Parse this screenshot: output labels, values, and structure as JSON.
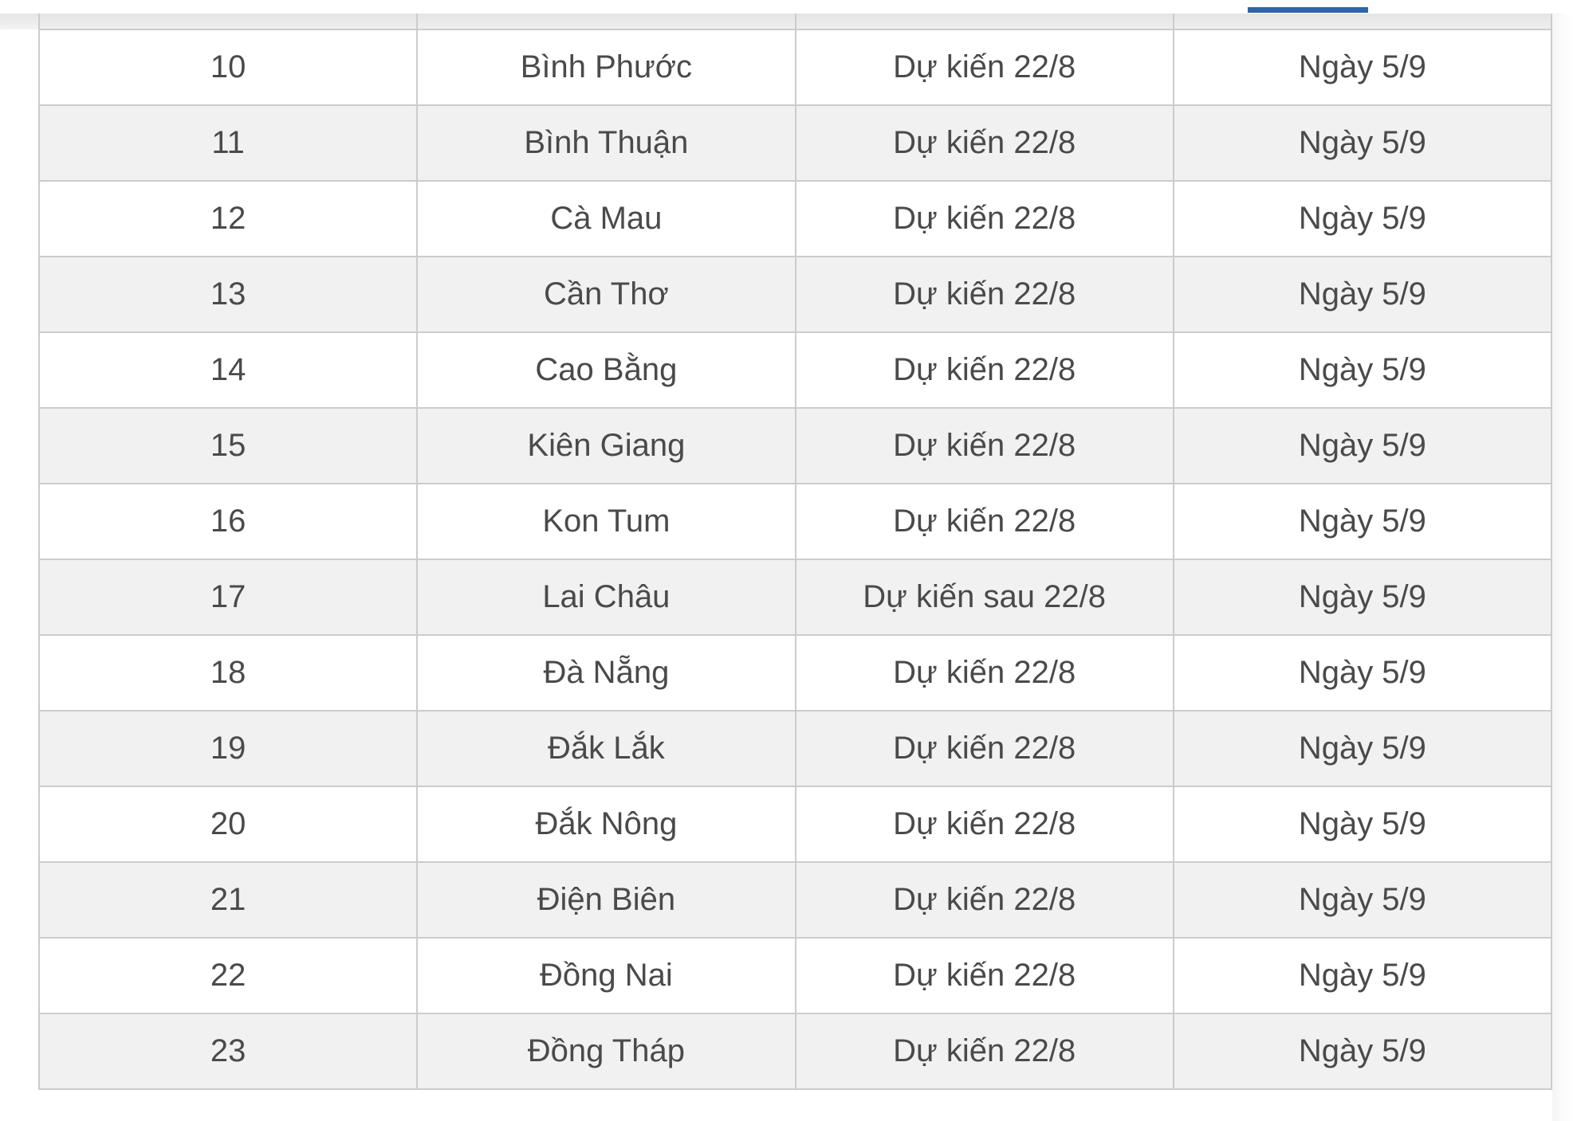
{
  "page": {
    "accent_color": "#2f64a8",
    "row_alt_color": "#f1f1f1",
    "border_color": "#cccccc",
    "text_color": "#4a4a4a"
  },
  "table": {
    "rows": [
      {
        "stt": "10",
        "province": "Bình Phước",
        "expected": "Dự kiến 22/8",
        "date": "Ngày 5/9"
      },
      {
        "stt": "11",
        "province": "Bình Thuận",
        "expected": "Dự kiến 22/8",
        "date": "Ngày 5/9"
      },
      {
        "stt": "12",
        "province": "Cà Mau",
        "expected": "Dự kiến 22/8",
        "date": "Ngày 5/9"
      },
      {
        "stt": "13",
        "province": "Cần Thơ",
        "expected": "Dự kiến 22/8",
        "date": "Ngày 5/9"
      },
      {
        "stt": "14",
        "province": "Cao Bằng",
        "expected": "Dự kiến 22/8",
        "date": "Ngày 5/9"
      },
      {
        "stt": "15",
        "province": "Kiên Giang",
        "expected": "Dự kiến 22/8",
        "date": "Ngày 5/9"
      },
      {
        "stt": "16",
        "province": "Kon Tum",
        "expected": "Dự kiến 22/8",
        "date": "Ngày 5/9"
      },
      {
        "stt": "17",
        "province": "Lai Châu",
        "expected": "Dự kiến sau 22/8",
        "date": "Ngày 5/9"
      },
      {
        "stt": "18",
        "province": "Đà Nẵng",
        "expected": "Dự kiến 22/8",
        "date": "Ngày 5/9"
      },
      {
        "stt": "19",
        "province": "Đắk Lắk",
        "expected": "Dự kiến 22/8",
        "date": "Ngày 5/9"
      },
      {
        "stt": "20",
        "province": "Đắk Nông",
        "expected": "Dự kiến 22/8",
        "date": "Ngày 5/9"
      },
      {
        "stt": "21",
        "province": "Điện Biên",
        "expected": "Dự kiến 22/8",
        "date": "Ngày 5/9"
      },
      {
        "stt": "22",
        "province": "Đồng Nai",
        "expected": "Dự kiến 22/8",
        "date": "Ngày 5/9"
      },
      {
        "stt": "23",
        "province": "Đồng Tháp",
        "expected": "Dự kiến 22/8",
        "date": "Ngày 5/9"
      }
    ]
  }
}
